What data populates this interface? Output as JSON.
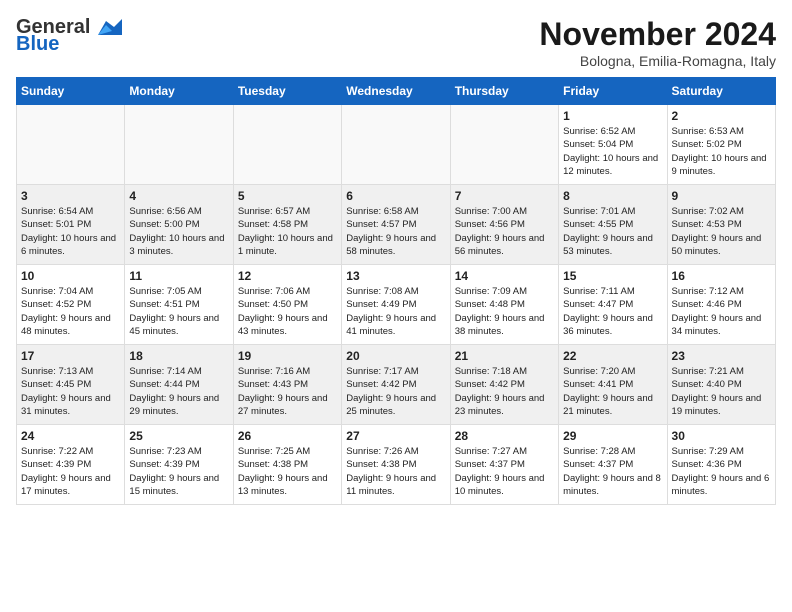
{
  "header": {
    "logo_general": "General",
    "logo_blue": "Blue",
    "month_title": "November 2024",
    "subtitle": "Bologna, Emilia-Romagna, Italy"
  },
  "days_of_week": [
    "Sunday",
    "Monday",
    "Tuesday",
    "Wednesday",
    "Thursday",
    "Friday",
    "Saturday"
  ],
  "weeks": [
    [
      {
        "num": "",
        "info": "",
        "empty": true
      },
      {
        "num": "",
        "info": "",
        "empty": true
      },
      {
        "num": "",
        "info": "",
        "empty": true
      },
      {
        "num": "",
        "info": "",
        "empty": true
      },
      {
        "num": "",
        "info": "",
        "empty": true
      },
      {
        "num": "1",
        "info": "Sunrise: 6:52 AM\nSunset: 5:04 PM\nDaylight: 10 hours and 12 minutes.",
        "empty": false
      },
      {
        "num": "2",
        "info": "Sunrise: 6:53 AM\nSunset: 5:02 PM\nDaylight: 10 hours and 9 minutes.",
        "empty": false
      }
    ],
    [
      {
        "num": "3",
        "info": "Sunrise: 6:54 AM\nSunset: 5:01 PM\nDaylight: 10 hours and 6 minutes.",
        "empty": false
      },
      {
        "num": "4",
        "info": "Sunrise: 6:56 AM\nSunset: 5:00 PM\nDaylight: 10 hours and 3 minutes.",
        "empty": false
      },
      {
        "num": "5",
        "info": "Sunrise: 6:57 AM\nSunset: 4:58 PM\nDaylight: 10 hours and 1 minute.",
        "empty": false
      },
      {
        "num": "6",
        "info": "Sunrise: 6:58 AM\nSunset: 4:57 PM\nDaylight: 9 hours and 58 minutes.",
        "empty": false
      },
      {
        "num": "7",
        "info": "Sunrise: 7:00 AM\nSunset: 4:56 PM\nDaylight: 9 hours and 56 minutes.",
        "empty": false
      },
      {
        "num": "8",
        "info": "Sunrise: 7:01 AM\nSunset: 4:55 PM\nDaylight: 9 hours and 53 minutes.",
        "empty": false
      },
      {
        "num": "9",
        "info": "Sunrise: 7:02 AM\nSunset: 4:53 PM\nDaylight: 9 hours and 50 minutes.",
        "empty": false
      }
    ],
    [
      {
        "num": "10",
        "info": "Sunrise: 7:04 AM\nSunset: 4:52 PM\nDaylight: 9 hours and 48 minutes.",
        "empty": false
      },
      {
        "num": "11",
        "info": "Sunrise: 7:05 AM\nSunset: 4:51 PM\nDaylight: 9 hours and 45 minutes.",
        "empty": false
      },
      {
        "num": "12",
        "info": "Sunrise: 7:06 AM\nSunset: 4:50 PM\nDaylight: 9 hours and 43 minutes.",
        "empty": false
      },
      {
        "num": "13",
        "info": "Sunrise: 7:08 AM\nSunset: 4:49 PM\nDaylight: 9 hours and 41 minutes.",
        "empty": false
      },
      {
        "num": "14",
        "info": "Sunrise: 7:09 AM\nSunset: 4:48 PM\nDaylight: 9 hours and 38 minutes.",
        "empty": false
      },
      {
        "num": "15",
        "info": "Sunrise: 7:11 AM\nSunset: 4:47 PM\nDaylight: 9 hours and 36 minutes.",
        "empty": false
      },
      {
        "num": "16",
        "info": "Sunrise: 7:12 AM\nSunset: 4:46 PM\nDaylight: 9 hours and 34 minutes.",
        "empty": false
      }
    ],
    [
      {
        "num": "17",
        "info": "Sunrise: 7:13 AM\nSunset: 4:45 PM\nDaylight: 9 hours and 31 minutes.",
        "empty": false
      },
      {
        "num": "18",
        "info": "Sunrise: 7:14 AM\nSunset: 4:44 PM\nDaylight: 9 hours and 29 minutes.",
        "empty": false
      },
      {
        "num": "19",
        "info": "Sunrise: 7:16 AM\nSunset: 4:43 PM\nDaylight: 9 hours and 27 minutes.",
        "empty": false
      },
      {
        "num": "20",
        "info": "Sunrise: 7:17 AM\nSunset: 4:42 PM\nDaylight: 9 hours and 25 minutes.",
        "empty": false
      },
      {
        "num": "21",
        "info": "Sunrise: 7:18 AM\nSunset: 4:42 PM\nDaylight: 9 hours and 23 minutes.",
        "empty": false
      },
      {
        "num": "22",
        "info": "Sunrise: 7:20 AM\nSunset: 4:41 PM\nDaylight: 9 hours and 21 minutes.",
        "empty": false
      },
      {
        "num": "23",
        "info": "Sunrise: 7:21 AM\nSunset: 4:40 PM\nDaylight: 9 hours and 19 minutes.",
        "empty": false
      }
    ],
    [
      {
        "num": "24",
        "info": "Sunrise: 7:22 AM\nSunset: 4:39 PM\nDaylight: 9 hours and 17 minutes.",
        "empty": false
      },
      {
        "num": "25",
        "info": "Sunrise: 7:23 AM\nSunset: 4:39 PM\nDaylight: 9 hours and 15 minutes.",
        "empty": false
      },
      {
        "num": "26",
        "info": "Sunrise: 7:25 AM\nSunset: 4:38 PM\nDaylight: 9 hours and 13 minutes.",
        "empty": false
      },
      {
        "num": "27",
        "info": "Sunrise: 7:26 AM\nSunset: 4:38 PM\nDaylight: 9 hours and 11 minutes.",
        "empty": false
      },
      {
        "num": "28",
        "info": "Sunrise: 7:27 AM\nSunset: 4:37 PM\nDaylight: 9 hours and 10 minutes.",
        "empty": false
      },
      {
        "num": "29",
        "info": "Sunrise: 7:28 AM\nSunset: 4:37 PM\nDaylight: 9 hours and 8 minutes.",
        "empty": false
      },
      {
        "num": "30",
        "info": "Sunrise: 7:29 AM\nSunset: 4:36 PM\nDaylight: 9 hours and 6 minutes.",
        "empty": false
      }
    ]
  ]
}
